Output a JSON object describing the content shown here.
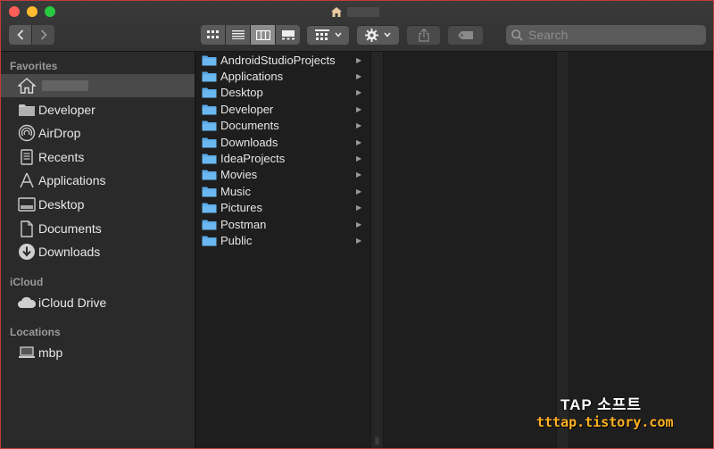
{
  "window": {
    "title_icon": "home-icon"
  },
  "toolbar": {
    "back_icon": "chevron-left-icon",
    "forward_icon": "chevron-right-icon",
    "view_modes": [
      "icon-view",
      "list-view",
      "column-view",
      "gallery-view"
    ],
    "active_view": "column-view",
    "search_placeholder": "Search"
  },
  "sidebar": {
    "favorites_title": "Favorites",
    "favorites": [
      {
        "label": "",
        "icon": "home-icon"
      },
      {
        "label": "Developer",
        "icon": "folder-icon"
      },
      {
        "label": "AirDrop",
        "icon": "airdrop-icon"
      },
      {
        "label": "Recents",
        "icon": "recents-icon"
      },
      {
        "label": "Applications",
        "icon": "applications-icon"
      },
      {
        "label": "Desktop",
        "icon": "desktop-icon"
      },
      {
        "label": "Documents",
        "icon": "document-icon"
      },
      {
        "label": "Downloads",
        "icon": "download-icon"
      }
    ],
    "icloud_title": "iCloud",
    "icloud": [
      {
        "label": "iCloud Drive",
        "icon": "cloud-icon"
      }
    ],
    "locations_title": "Locations",
    "locations": [
      {
        "label": "mbp",
        "icon": "laptop-icon"
      }
    ]
  },
  "column1": {
    "items": [
      {
        "label": "AndroidStudioProjects"
      },
      {
        "label": "Applications"
      },
      {
        "label": "Desktop"
      },
      {
        "label": "Developer"
      },
      {
        "label": "Documents"
      },
      {
        "label": "Downloads"
      },
      {
        "label": "IdeaProjects"
      },
      {
        "label": "Movies"
      },
      {
        "label": "Music"
      },
      {
        "label": "Pictures"
      },
      {
        "label": "Postman"
      },
      {
        "label": "Public"
      }
    ]
  },
  "watermark": {
    "line1": "TAP 소프트",
    "line2": "tttap.tistory.com"
  },
  "colors": {
    "folder_blue": "#5aa9e6",
    "selected_bg": "#4a4a4a"
  }
}
